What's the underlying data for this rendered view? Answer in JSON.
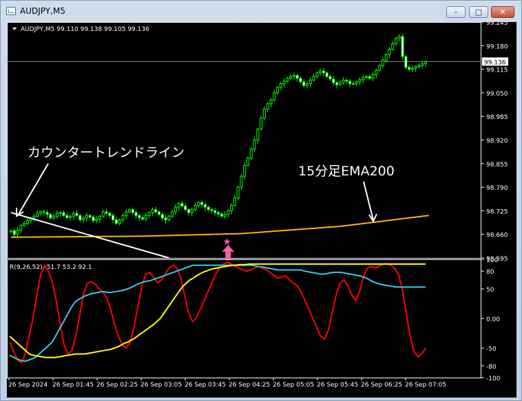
{
  "window": {
    "title": "AUDJPY,M5",
    "min": "–",
    "max": "□",
    "close": "✕"
  },
  "colors": {
    "bg": "#000000",
    "axis": "#ffffff",
    "grid": "#ffffff",
    "candle": "#00ff00",
    "ema": "#ffb400",
    "trend": "#ffffff",
    "rci_short": "#ff0000",
    "rci_mid": "#33ccee",
    "rci_long": "#ffff00",
    "arrow": "#ff5aa0",
    "price_line": "#708090"
  },
  "chart_data": [
    {
      "type": "candlestick",
      "title": "AUDJPY,M5 99.110 99.138 99.105 99.136",
      "ylim": [
        98.595,
        99.245
      ],
      "y_ticks": [
        99.245,
        99.18,
        99.115,
        99.05,
        98.985,
        98.92,
        98.855,
        98.79,
        98.725,
        98.66,
        98.595
      ],
      "current_price": "99.136",
      "close_series": [
        98.67,
        98.66,
        98.672,
        98.685,
        98.69,
        98.698,
        98.705,
        98.71,
        98.718,
        98.722,
        98.72,
        98.715,
        98.705,
        98.71,
        98.718,
        98.72,
        98.712,
        98.706,
        98.71,
        98.718,
        98.712,
        98.7,
        98.705,
        98.712,
        98.708,
        98.698,
        98.702,
        98.71,
        98.722,
        98.718,
        98.712,
        98.7,
        98.69,
        98.7,
        98.712,
        98.722,
        98.728,
        98.72,
        98.712,
        98.706,
        98.702,
        98.712,
        98.72,
        98.728,
        98.722,
        98.715,
        98.705,
        98.7,
        98.71,
        98.722,
        98.735,
        98.745,
        98.738,
        98.728,
        98.72,
        98.728,
        98.74,
        98.748,
        98.742,
        98.735,
        98.728,
        98.725,
        98.72,
        98.716,
        98.71,
        98.715,
        98.725,
        98.74,
        98.76,
        98.79,
        98.82,
        98.85,
        98.87,
        98.895,
        98.92,
        98.95,
        98.98,
        99.005,
        99.02,
        99.03,
        99.05,
        99.065,
        99.075,
        99.082,
        99.09,
        99.095,
        99.098,
        99.09,
        99.08,
        99.07,
        99.075,
        99.085,
        99.095,
        99.105,
        99.11,
        99.105,
        99.095,
        99.088,
        99.078,
        99.072,
        99.078,
        99.085,
        99.082,
        99.075,
        99.075,
        99.08,
        99.086,
        99.092,
        99.095,
        99.09,
        99.1,
        99.112,
        99.125,
        99.14,
        99.155,
        99.17,
        99.185,
        99.2,
        99.205,
        99.15,
        99.12,
        99.115,
        99.118,
        99.122,
        99.125,
        99.13,
        99.136
      ],
      "ema200": [
        [
          0,
          98.652
        ],
        [
          40,
          98.655
        ],
        [
          70,
          98.662
        ],
        [
          100,
          98.682
        ],
        [
          127,
          98.712
        ]
      ],
      "trendline": [
        [
          0,
          98.72
        ],
        [
          48,
          98.595
        ]
      ],
      "annotations": {
        "trendline_label": "カウンタートレンドライン",
        "ema_label": "15分足EMA200"
      },
      "marker_index": 66
    },
    {
      "type": "line",
      "title": "R(9,26,52) -51.7 53.2 92.1",
      "ylim": [
        -100,
        100
      ],
      "y_ticks": [
        "100",
        "80",
        "50",
        "0.00",
        "-50",
        "-80",
        "-100"
      ],
      "series": [
        {
          "color": "#ff0000",
          "values": [
            -40,
            -55,
            -70,
            -75,
            -60,
            -30,
            0,
            40,
            75,
            90,
            80,
            60,
            30,
            -10,
            -45,
            -60,
            -55,
            -30,
            5,
            40,
            60,
            62,
            58,
            50,
            45,
            35,
            15,
            -10,
            -30,
            -45,
            -50,
            -40,
            -15,
            20,
            55,
            75,
            78,
            70,
            60,
            65,
            75,
            85,
            90,
            85,
            70,
            40,
            10,
            -5,
            0,
            15,
            30,
            45,
            60,
            75,
            85,
            92,
            95,
            92,
            88,
            85,
            82,
            80,
            82,
            85,
            88,
            85,
            82,
            78,
            72,
            68,
            70,
            72,
            65,
            60,
            55,
            45,
            30,
            15,
            0,
            -15,
            -30,
            -35,
            -20,
            10,
            40,
            60,
            65,
            55,
            40,
            30,
            45,
            70,
            85,
            88,
            85,
            88,
            92,
            93,
            90,
            85,
            75,
            50,
            10,
            -30,
            -55,
            -65,
            -60,
            -50
          ]
        },
        {
          "color": "#33ccee",
          "values": [
            -62,
            -65,
            -68,
            -70,
            -72,
            -72,
            -70,
            -68,
            -65,
            -60,
            -55,
            -50,
            -45,
            -40,
            -30,
            -20,
            -10,
            0,
            10,
            20,
            28,
            32,
            35,
            38,
            40,
            42,
            43,
            44,
            45,
            45,
            44,
            44,
            45,
            46,
            47,
            48,
            50,
            52,
            55,
            58,
            60,
            62,
            63,
            64,
            66,
            68,
            70,
            72,
            74,
            76,
            78,
            80,
            82,
            84,
            86,
            88,
            90,
            90,
            90,
            90,
            90,
            90,
            90,
            90,
            90,
            90,
            90,
            90,
            90,
            90,
            90,
            90,
            90,
            90,
            90,
            89,
            88,
            87,
            86,
            85,
            84,
            83,
            82,
            82,
            82,
            82,
            82,
            82,
            82,
            82,
            80,
            79,
            78,
            77,
            76,
            75,
            75,
            76,
            77,
            78,
            78,
            78,
            77,
            76,
            75,
            74,
            73,
            72,
            70,
            68,
            65,
            62,
            60,
            58,
            57,
            56,
            55,
            54,
            53,
            53,
            53,
            53,
            53,
            53,
            53,
            53,
            53,
            53
          ]
        },
        {
          "color": "#ffff00",
          "values": [
            -30,
            -35,
            -40,
            -45,
            -50,
            -55,
            -60,
            -62,
            -63,
            -64,
            -65,
            -66,
            -66,
            -66,
            -66,
            -65,
            -64,
            -63,
            -62,
            -61,
            -60,
            -60,
            -60,
            -60,
            -59,
            -58,
            -57,
            -56,
            -55,
            -54,
            -53,
            -52,
            -50,
            -48,
            -45,
            -42,
            -40,
            -37,
            -34,
            -30,
            -26,
            -22,
            -18,
            -14,
            -10,
            -5,
            0,
            8,
            16,
            24,
            32,
            40,
            48,
            55,
            60,
            65,
            68,
            72,
            75,
            78,
            80,
            82,
            84,
            85,
            86,
            87,
            88,
            89,
            90,
            90,
            91,
            91,
            91,
            92,
            92,
            92,
            92,
            92,
            92,
            92,
            92,
            92,
            92,
            92,
            92,
            92,
            92,
            92,
            92,
            92,
            92,
            92,
            92,
            92,
            92,
            92,
            92,
            92,
            92,
            92,
            92,
            92,
            92,
            92,
            92,
            92,
            92,
            92,
            92,
            92,
            92,
            92,
            92,
            92,
            92,
            92,
            92,
            92,
            92,
            92,
            92,
            92,
            92,
            92,
            92,
            92,
            92,
            92
          ]
        }
      ]
    }
  ],
  "x_labels": [
    "26 Sep 2024",
    "26 Sep 01:45",
    "26 Sep 02:25",
    "26 Sep 03:05",
    "26 Sep 03:45",
    "26 Sep 04:25",
    "26 Sep 05:05",
    "26 Sep 05:45",
    "26 Sep 06:25",
    "26 Sep 07:05"
  ]
}
